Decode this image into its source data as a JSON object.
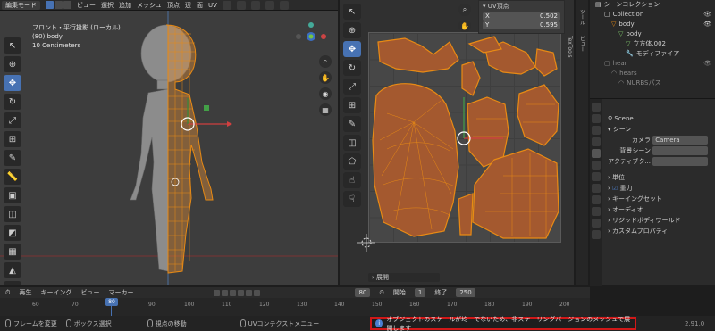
{
  "viewport_header": {
    "mode": "編集モード",
    "menus": [
      "ビュー",
      "選択",
      "追加",
      "メッシュ",
      "頂点",
      "辺",
      "面",
      "UV"
    ]
  },
  "viewport": {
    "view_title": "フロント・平行投影 (ローカル)",
    "object": "(80) body",
    "scale": "10 Centimeters"
  },
  "uv_editor": {
    "panel_tab": "UV頂点",
    "x_label": "X",
    "x_value": "0.502",
    "y_label": "Y",
    "y_value": "0.595",
    "side_tab": "TexTools",
    "unwrap_label": "展開"
  },
  "outliner": {
    "scene_collection": "シーンコレクション",
    "items": [
      {
        "label": "Collection",
        "indent": 1
      },
      {
        "label": "body",
        "indent": 2
      },
      {
        "label": "body",
        "indent": 3
      },
      {
        "label": "立方体.002",
        "indent": 4
      },
      {
        "label": "モディファイア",
        "indent": 4
      },
      {
        "label": "hear",
        "indent": 1
      },
      {
        "label": "hears",
        "indent": 2
      },
      {
        "label": "NURBSパス",
        "indent": 3
      }
    ]
  },
  "properties": {
    "scene_name": "Scene",
    "section_scene": "シーン",
    "camera_label": "カメラ",
    "camera_value": "Camera",
    "bg_scene_label": "背景シーン",
    "active_clip_label": "アクティブク...",
    "panels": [
      "単位",
      "重力",
      "キーイングセット",
      "オーディオ",
      "リジッドボディワールド",
      "カスタムプロパティ"
    ]
  },
  "side_tabs": [
    "ツール",
    "ビュー"
  ],
  "timeline": {
    "menus": [
      "再生",
      "キーイング",
      "ビュー",
      "マーカー"
    ],
    "current_frame": "80",
    "start_label": "開始",
    "start_value": "1",
    "end_label": "終了",
    "end_value": "250",
    "ruler_ticks": [
      "60",
      "70",
      "80",
      "90",
      "100",
      "110",
      "120",
      "130",
      "140",
      "150",
      "160",
      "170",
      "180",
      "190",
      "200"
    ]
  },
  "statusbar": {
    "items": [
      "フレームを変更",
      "ボックス選択",
      "視点の移動",
      "UVコンテクストメニュー"
    ],
    "warning": "オブジェクトのスケールが均一でないため、非スケーリングバージョンのメッシュで展開します",
    "version": "2.91.0"
  },
  "colors": {
    "accent": "#4772b3",
    "mesh_orange": "#e88a14",
    "uv_face": "#a4592f",
    "warning_border": "#d01818"
  }
}
